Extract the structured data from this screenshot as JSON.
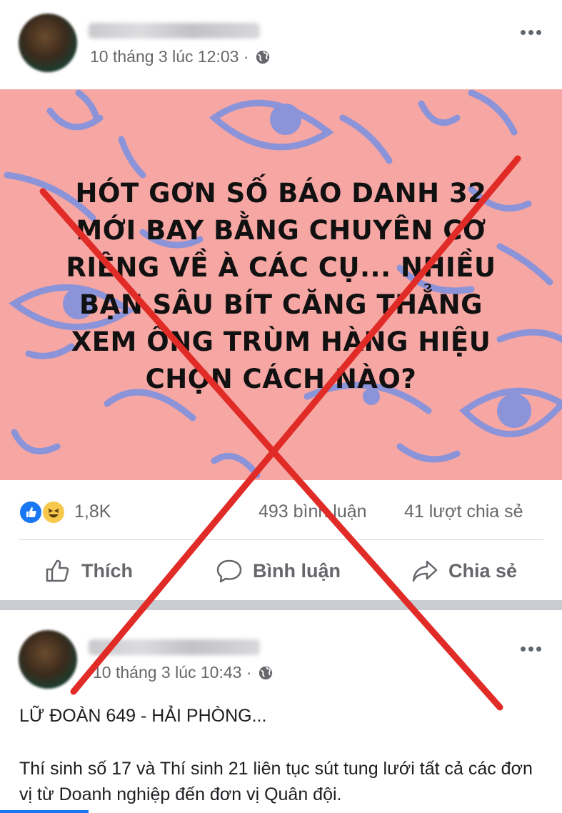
{
  "post1": {
    "timestamp": "10 tháng 3 lúc 12:03 ·",
    "image_headline": "HÓT GƠN SỐ BÁO DANH 32\nMỚI BAY BẰNG CHUYÊN CƠ\nRIÊNG VỀ À CÁC CỤ... NHIỀU\nBẠN SÂU BÍT CĂNG THẲNG\nXEM ÔNG TRÙM HÀNG HIỆU\nCHỌN CÁCH NÀO?",
    "reactions_count": "1,8K",
    "comments_count": "493 bình luận",
    "shares_count": "41 lượt chia sẻ",
    "actions": {
      "like": "Thích",
      "comment": "Bình luận",
      "share": "Chia sẻ"
    },
    "image_background_color": "#f7a7a3",
    "pattern_color": "#8b93d9"
  },
  "post2": {
    "timestamp": "10 tháng 3 lúc 10:43 ·",
    "title_line": "LỮ ĐOÀN 649 - HẢI PHÒNG...",
    "body": "Thí sinh số 17 và Thí sinh 21 liên tục sút tung lưới tất cả các đơn vị từ Doanh nghiệp đến đơn vị Quân đội."
  },
  "overlay": {
    "type": "red-x-mark",
    "color": "#e12b27"
  }
}
